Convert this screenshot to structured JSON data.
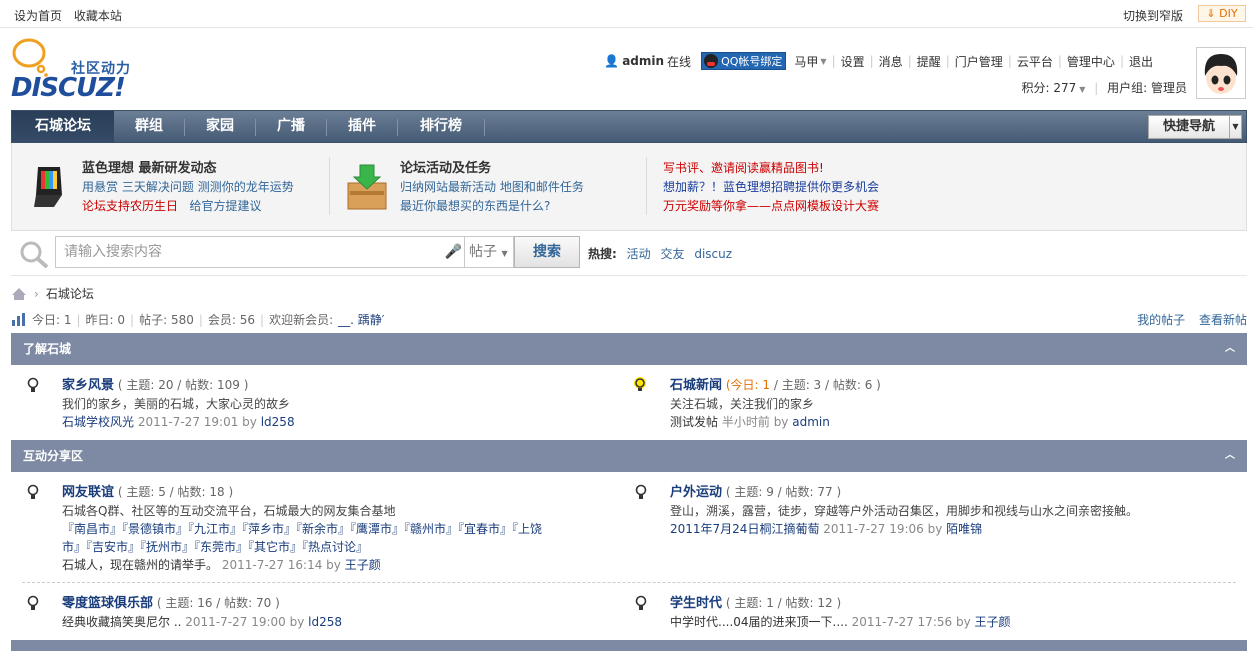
{
  "topbar": {
    "set_home": "设为首页",
    "bookmark": "收藏本站",
    "switch_width": "切换到窄版",
    "diy": "DIY"
  },
  "header": {
    "logo_text": "社区动力",
    "logo_brand": "DISCUZ!",
    "username": "admin",
    "online": "在线",
    "qq_bind": "QQ帐号绑定",
    "menu": [
      "马甲",
      "设置",
      "消息",
      "提醒",
      "门户管理",
      "云平台",
      "管理中心",
      "退出"
    ],
    "credit_label": "积分: 277",
    "usergroup": "用户组: 管理员"
  },
  "nav": {
    "items": [
      "石城论坛",
      "群组",
      "家园",
      "广播",
      "插件",
      "排行榜"
    ],
    "quick": "快捷导航"
  },
  "promo": {
    "block1": {
      "title": "蓝色理想 最新研发动态",
      "line1_a": "用悬赏",
      "line1_b": "三天解决问题",
      "line1_c": "测测你的龙年运势",
      "line2_a": "论坛支持农历生日",
      "line2_b": "给官方提建议"
    },
    "block2": {
      "title": "论坛活动及任务",
      "line1_a": "归纳网站最新活动",
      "line1_b": "地图和邮件任务",
      "line2": "最近你最想买的东西是什么?"
    },
    "block3": {
      "line1": "写书评、邀请阅读赢精品图书!",
      "line2": "想加薪？！蓝色理想招聘提供你更多机会",
      "line3": "万元奖励等你拿——点点网模板设计大赛"
    }
  },
  "search": {
    "placeholder": "请输入搜索内容",
    "type": "帖子",
    "button": "搜索",
    "hot_label": "热搜:",
    "hot": [
      "活动",
      "交友",
      "discuz"
    ]
  },
  "breadcrumb": {
    "current": "石城论坛"
  },
  "stats": {
    "today": "今日: 1",
    "yesterday": "昨日: 0",
    "posts": "帖子: 580",
    "members": "会员: 56",
    "welcome": "欢迎新会员:",
    "newmember": "__. 踽静′"
  },
  "mylinks": {
    "my_posts": "我的帖子",
    "view_new": "查看新帖"
  },
  "categories": [
    {
      "title": "了解石城"
    },
    {
      "title": "互动分享区"
    }
  ],
  "forums": {
    "f1": {
      "name": "家乡风景",
      "count": "( 主题: 20 / 帖数: 109 )",
      "desc": "我们的家乡，美丽的石城，大家心灵的故乡",
      "last_title": "石城学校风光",
      "last_time": "2011-7-27 19:01",
      "by": "by",
      "last_user": "ld258"
    },
    "f2": {
      "name": "石城新闻",
      "today": "(今日: 1",
      "count": " / 主题: 3 / 帖数: 6 )",
      "desc": "关注石城，关注我们的家乡",
      "last_title": "测试发帖",
      "last_time": "半小时前",
      "by": "by",
      "last_user": "admin"
    },
    "f3": {
      "name": "网友联谊",
      "count": "( 主题: 5 / 帖数: 18 )",
      "desc": "石城各Q群、社区等的互动交流平台，石城最大的网友集合基地",
      "sub1": "『南昌市』『景德镇市』『九江市』『萍乡市』『新余市』『鹰潭市』『赣州市』『宜春市』『上饶",
      "sub2": "市』『吉安市』『抚州市』『东莞市』『其它市』『热点讨论』",
      "last_title": "石城人，现在赣州的请举手。",
      "last_time": "2011-7-27 16:14",
      "by": "by",
      "last_user": "王子颜"
    },
    "f4": {
      "name": "户外运动",
      "count": "( 主题: 9 / 帖数: 77 )",
      "desc": "登山，溯溪，露营，徒步，穿越等户外活动召集区，用脚步和视线与山水之间亲密接触。",
      "last_title": "2011年7月24日桐江摘葡萄",
      "last_time": "2011-7-27 19:06",
      "by": "by",
      "last_user": "陌唯锦"
    },
    "f5": {
      "name": "零度篮球俱乐部",
      "count": "( 主题: 16 / 帖数: 70 )",
      "last_title": "经典收藏搞笑奥尼尔 ..",
      "last_time": "2011-7-27 19:00",
      "by": "by",
      "last_user": "ld258"
    },
    "f6": {
      "name": "学生时代",
      "count": "( 主题: 1 / 帖数: 12 )",
      "last_title": "中学时代....04届的进来顶一下....",
      "last_time": "2011-7-27 17:56",
      "by": "by",
      "last_user": "王子颜"
    }
  }
}
